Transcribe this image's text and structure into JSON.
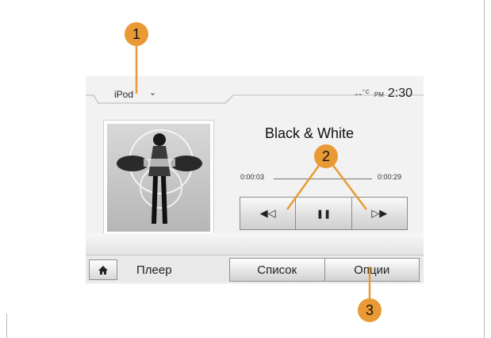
{
  "header": {
    "source": "iPod",
    "temperature": "--",
    "temp_unit": "°C",
    "ampm": "PM",
    "clock": "2:30"
  },
  "track": {
    "title": "Black & White",
    "elapsed": "0:00:03",
    "duration": "0:00:29"
  },
  "controls": {
    "rewind": "◀◁",
    "pause": "❚❚",
    "forward": "▷▶"
  },
  "bottom_bar": {
    "current_label": "Плеер",
    "list_label": "Список",
    "options_label": "Опции"
  },
  "callouts": [
    "1",
    "2",
    "3"
  ],
  "colors": {
    "callout": "#e99a34",
    "screen": "#f2f2f2",
    "button_border": "#8f8f8f"
  },
  "icons": {
    "home": "home-icon",
    "source_dropdown": "chevron-down-icon"
  }
}
